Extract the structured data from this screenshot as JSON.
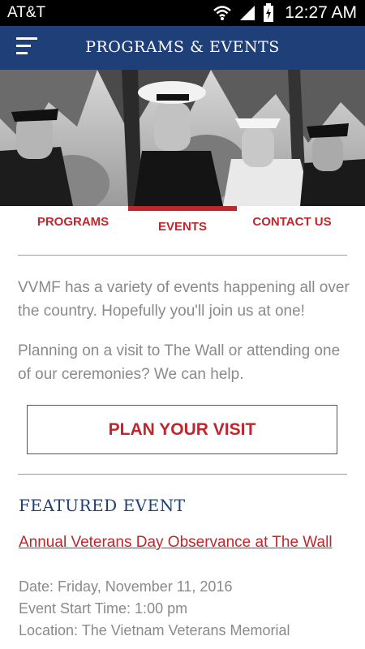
{
  "status_bar": {
    "carrier": "AT&T",
    "time": "12:27 AM",
    "icons": [
      "wifi-icon",
      "signal-icon",
      "battery-icon"
    ]
  },
  "app_bar": {
    "title": "PROGRAMS & EVENTS",
    "menu_icon": "hamburger-menu-icon",
    "background": "#1f3f78"
  },
  "tabs": [
    {
      "label": "PROGRAMS",
      "active": false
    },
    {
      "label": "EVENTS",
      "active": true
    },
    {
      "label": "CONTACT US",
      "active": false
    }
  ],
  "intro": {
    "p1": "VVMF has a variety of events happening all over the country.  Hopefully you'll join us at one!",
    "p2": "Planning on a visit to The Wall or attending one of our ceremonies?  We can help."
  },
  "cta": {
    "label": "PLAN YOUR VISIT"
  },
  "featured": {
    "heading": "FEATURED EVENT",
    "event_title": "Annual Veterans Day Observance at The Wall",
    "date": "Date: Friday, November 11, 2016",
    "start_time": "Event Start Time: 1:00 pm",
    "location": "Location: The Vietnam Veterans Memorial"
  },
  "colors": {
    "accent": "#c0262c",
    "brand_navy": "#1f3f78",
    "body_text": "#8a8a8a"
  }
}
